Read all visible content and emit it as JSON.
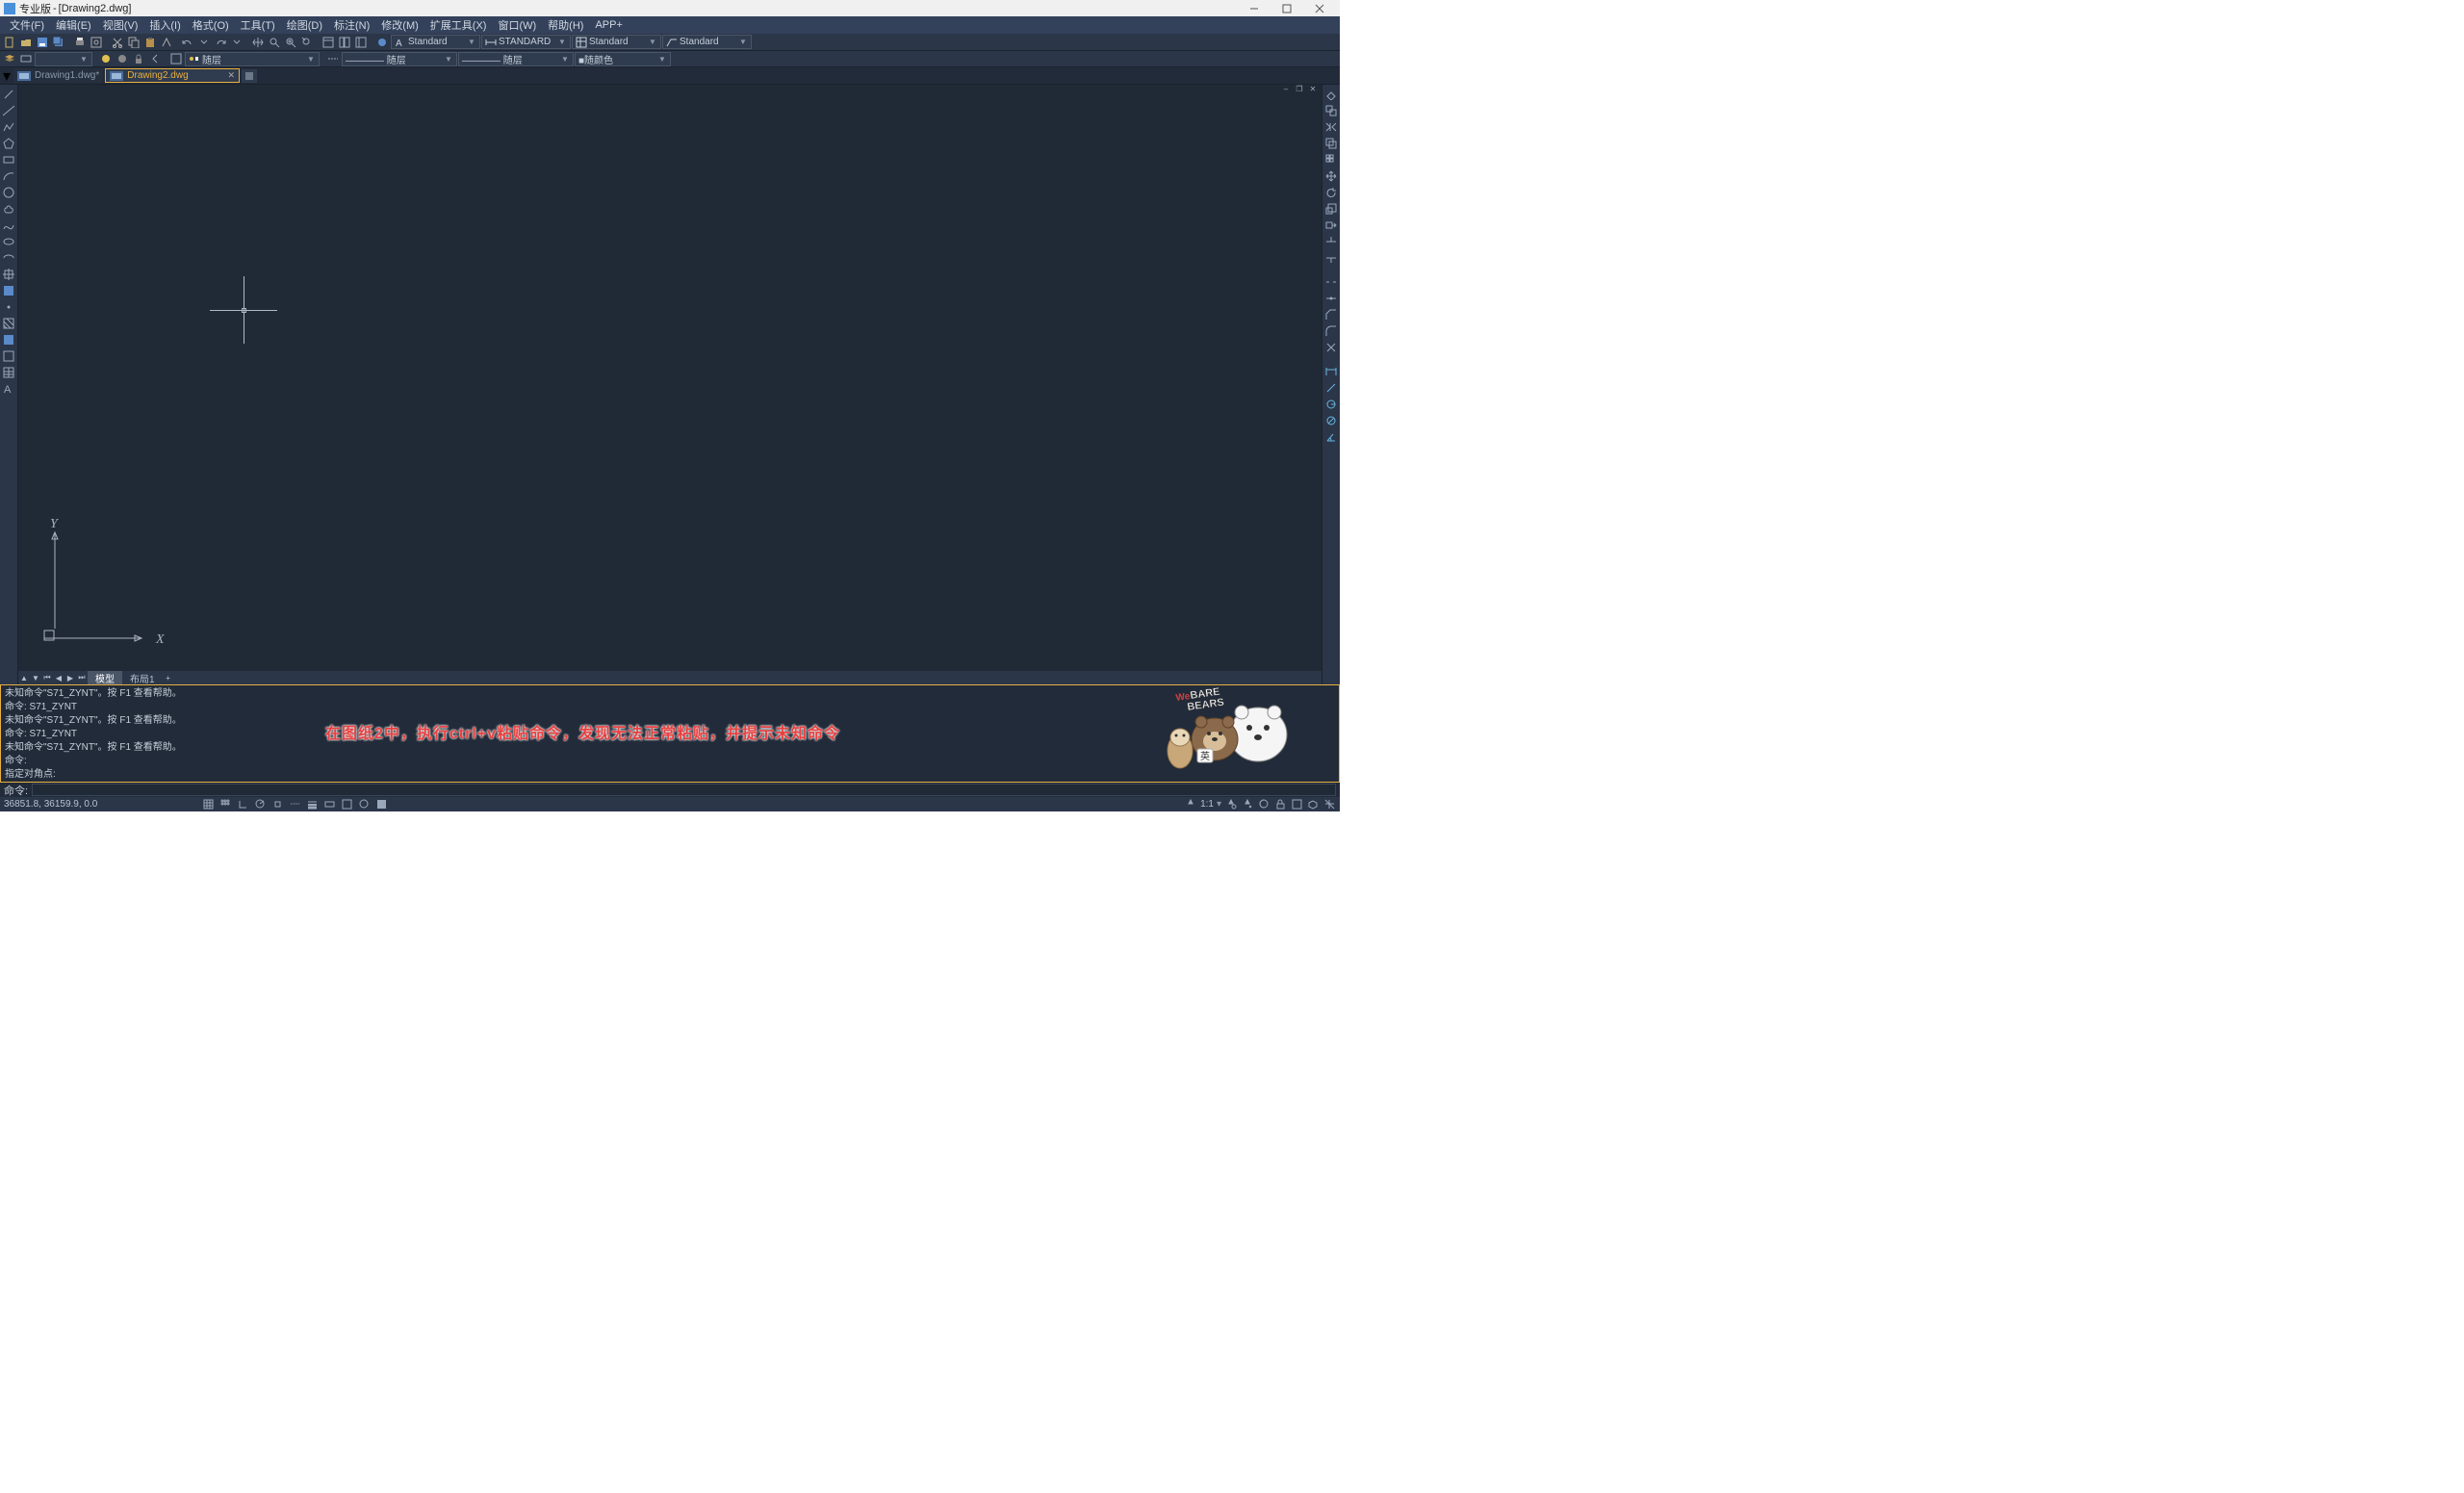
{
  "title": {
    "app_name": "专业版",
    "doc": "[Drawing2.dwg]"
  },
  "menu": [
    "文件(F)",
    "编辑(E)",
    "视图(V)",
    "插入(I)",
    "格式(O)",
    "工具(T)",
    "绘图(D)",
    "标注(N)",
    "修改(M)",
    "扩展工具(X)",
    "窗口(W)",
    "帮助(H)",
    "APP+"
  ],
  "style_combos": {
    "text": "Standard",
    "dim": "STANDARD",
    "table": "Standard",
    "mleader": "Standard"
  },
  "layer_row": {
    "layer": "随层",
    "lt": "———— 随层",
    "lw": "———— 随层",
    "color": "■随颜色"
  },
  "tabs": [
    {
      "label": "Drawing1.dwg*",
      "active": false
    },
    {
      "label": "Drawing2.dwg",
      "active": true
    }
  ],
  "layout": {
    "model": "模型",
    "l1": "布局1"
  },
  "axes": {
    "x": "X",
    "y": "Y"
  },
  "cmd_log": [
    "未知命令\"S71_ZYNT\"。按 F1 查看帮助。",
    "命令: S71_ZYNT",
    "未知命令\"S71_ZYNT\"。按 F1 查看帮助。",
    "命令: S71_ZYNT",
    "未知命令\"S71_ZYNT\"。按 F1 查看帮助。",
    "命令:",
    "指定对角点:"
  ],
  "cmd_prompt": "命令:",
  "status": {
    "coords": "36851.8, 36159.9, 0.0",
    "scale": "1:1"
  },
  "annotation": "在图纸2中，执行ctrl+v粘贴命令，发现无法正常粘贴，并提示未知命令",
  "mascot": {
    "brand": "We BARE BEARS",
    "ime": "英"
  }
}
